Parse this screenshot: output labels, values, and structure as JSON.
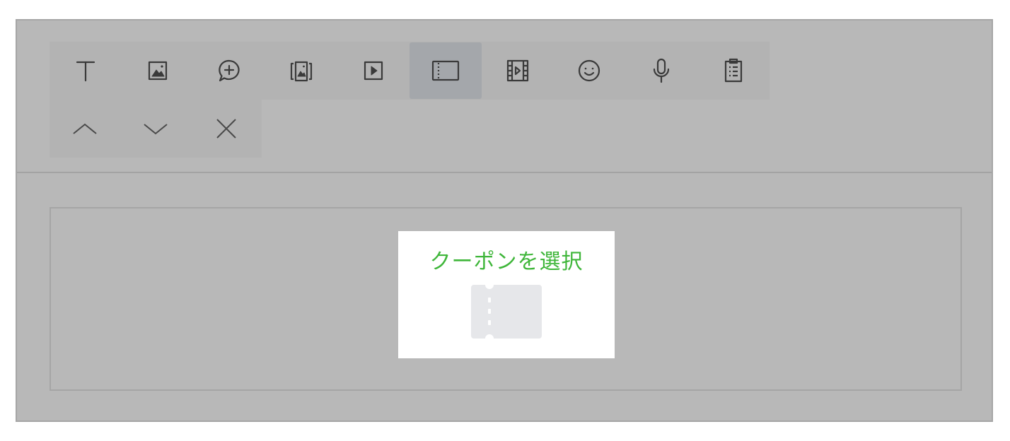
{
  "colors": {
    "icon": "#3a3a3a",
    "accent": "#3fb63a",
    "placeholder": "#e6e7ea",
    "active_tool_bg": "#a4a7ab"
  },
  "toolbar": {
    "row1": [
      {
        "name": "text",
        "icon": "text-icon"
      },
      {
        "name": "image",
        "icon": "image-icon"
      },
      {
        "name": "sticker",
        "icon": "plus-speech-bubble-icon"
      },
      {
        "name": "image-carousel",
        "icon": "image-carousel-icon"
      },
      {
        "name": "video",
        "icon": "play-icon"
      },
      {
        "name": "coupon",
        "icon": "coupon-icon",
        "active": true
      },
      {
        "name": "movie",
        "icon": "film-icon"
      },
      {
        "name": "emoji",
        "icon": "smiley-icon"
      },
      {
        "name": "voice",
        "icon": "microphone-icon"
      },
      {
        "name": "survey",
        "icon": "clipboard-icon"
      }
    ],
    "row2": [
      {
        "name": "move-up",
        "icon": "chevron-up-icon"
      },
      {
        "name": "move-down",
        "icon": "chevron-down-icon"
      },
      {
        "name": "delete",
        "icon": "close-icon"
      }
    ]
  },
  "content": {
    "coupon": {
      "title": "クーポンを選択",
      "icon": "coupon-placeholder-icon"
    }
  }
}
